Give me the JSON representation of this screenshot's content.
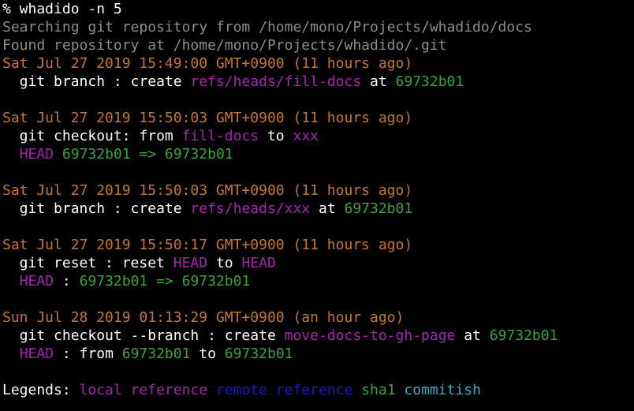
{
  "colors": {
    "default": "#ffffff",
    "gray": "#8c8c8c",
    "date": "#c5762e",
    "local_ref": "#a623b0",
    "remote_ref": "#1818c8",
    "sha1": "#3ba13b",
    "commitish": "#2fb0bd"
  },
  "lines": [
    {
      "segments": [
        {
          "text": "% whadido -n 5",
          "color": "default"
        }
      ]
    },
    {
      "segments": [
        {
          "text": "Searching git repository from /home/mono/Projects/whadido/docs",
          "color": "gray"
        }
      ]
    },
    {
      "segments": [
        {
          "text": "Found repository at /home/mono/Projects/whadido/.git",
          "color": "gray"
        }
      ]
    },
    {
      "segments": [
        {
          "text": "Sat Jul 27 2019 15:49:00 GMT+0900 (11 hours ago)",
          "color": "date"
        }
      ]
    },
    {
      "segments": [
        {
          "text": "  git branch : create ",
          "color": "default"
        },
        {
          "text": "refs/heads/fill-docs",
          "color": "local_ref"
        },
        {
          "text": " at ",
          "color": "default"
        },
        {
          "text": "69732b01",
          "color": "sha1"
        }
      ]
    },
    {
      "blank": true
    },
    {
      "segments": [
        {
          "text": "Sat Jul 27 2019 15:50:03 GMT+0900 (11 hours ago)",
          "color": "date"
        }
      ]
    },
    {
      "segments": [
        {
          "text": "  git checkout: from ",
          "color": "default"
        },
        {
          "text": "fill-docs",
          "color": "local_ref"
        },
        {
          "text": " to ",
          "color": "default"
        },
        {
          "text": "xxx",
          "color": "local_ref"
        }
      ]
    },
    {
      "segments": [
        {
          "text": "  ",
          "color": "default"
        },
        {
          "text": "HEAD",
          "color": "local_ref"
        },
        {
          "text": " ",
          "color": "default"
        },
        {
          "text": "69732b01 => 69732b01",
          "color": "sha1"
        }
      ]
    },
    {
      "blank": true
    },
    {
      "segments": [
        {
          "text": "Sat Jul 27 2019 15:50:03 GMT+0900 (11 hours ago)",
          "color": "date"
        }
      ]
    },
    {
      "segments": [
        {
          "text": "  git branch : create ",
          "color": "default"
        },
        {
          "text": "refs/heads/xxx",
          "color": "local_ref"
        },
        {
          "text": " at ",
          "color": "default"
        },
        {
          "text": "69732b01",
          "color": "sha1"
        }
      ]
    },
    {
      "blank": true
    },
    {
      "segments": [
        {
          "text": "Sat Jul 27 2019 15:50:17 GMT+0900 (11 hours ago)",
          "color": "date"
        }
      ]
    },
    {
      "segments": [
        {
          "text": "  git reset : reset ",
          "color": "default"
        },
        {
          "text": "HEAD",
          "color": "local_ref"
        },
        {
          "text": " to ",
          "color": "default"
        },
        {
          "text": "HEAD",
          "color": "local_ref"
        }
      ]
    },
    {
      "segments": [
        {
          "text": "  ",
          "color": "default"
        },
        {
          "text": "HEAD",
          "color": "local_ref"
        },
        {
          "text": " : ",
          "color": "default"
        },
        {
          "text": "69732b01 => 69732b01",
          "color": "sha1"
        }
      ]
    },
    {
      "blank": true
    },
    {
      "segments": [
        {
          "text": "Sun Jul 28 2019 01:13:29 GMT+0900 (an hour ago)",
          "color": "date"
        }
      ]
    },
    {
      "segments": [
        {
          "text": "  git checkout --branch : create ",
          "color": "default"
        },
        {
          "text": "move-docs-to-gh-page",
          "color": "local_ref"
        },
        {
          "text": " at ",
          "color": "default"
        },
        {
          "text": "69732b01",
          "color": "sha1"
        }
      ]
    },
    {
      "segments": [
        {
          "text": "  ",
          "color": "default"
        },
        {
          "text": "HEAD",
          "color": "local_ref"
        },
        {
          "text": " : from ",
          "color": "default"
        },
        {
          "text": "69732b01",
          "color": "sha1"
        },
        {
          "text": " to ",
          "color": "default"
        },
        {
          "text": "69732b01",
          "color": "sha1"
        }
      ]
    },
    {
      "blank": true
    },
    {
      "segments": [
        {
          "text": "Legends: ",
          "color": "default"
        },
        {
          "text": "local reference",
          "color": "local_ref"
        },
        {
          "text": " ",
          "color": "default"
        },
        {
          "text": "remote reference",
          "color": "remote_ref"
        },
        {
          "text": " ",
          "color": "default"
        },
        {
          "text": "sha1",
          "color": "sha1"
        },
        {
          "text": " ",
          "color": "default"
        },
        {
          "text": "commitish",
          "color": "commitish"
        }
      ]
    }
  ]
}
